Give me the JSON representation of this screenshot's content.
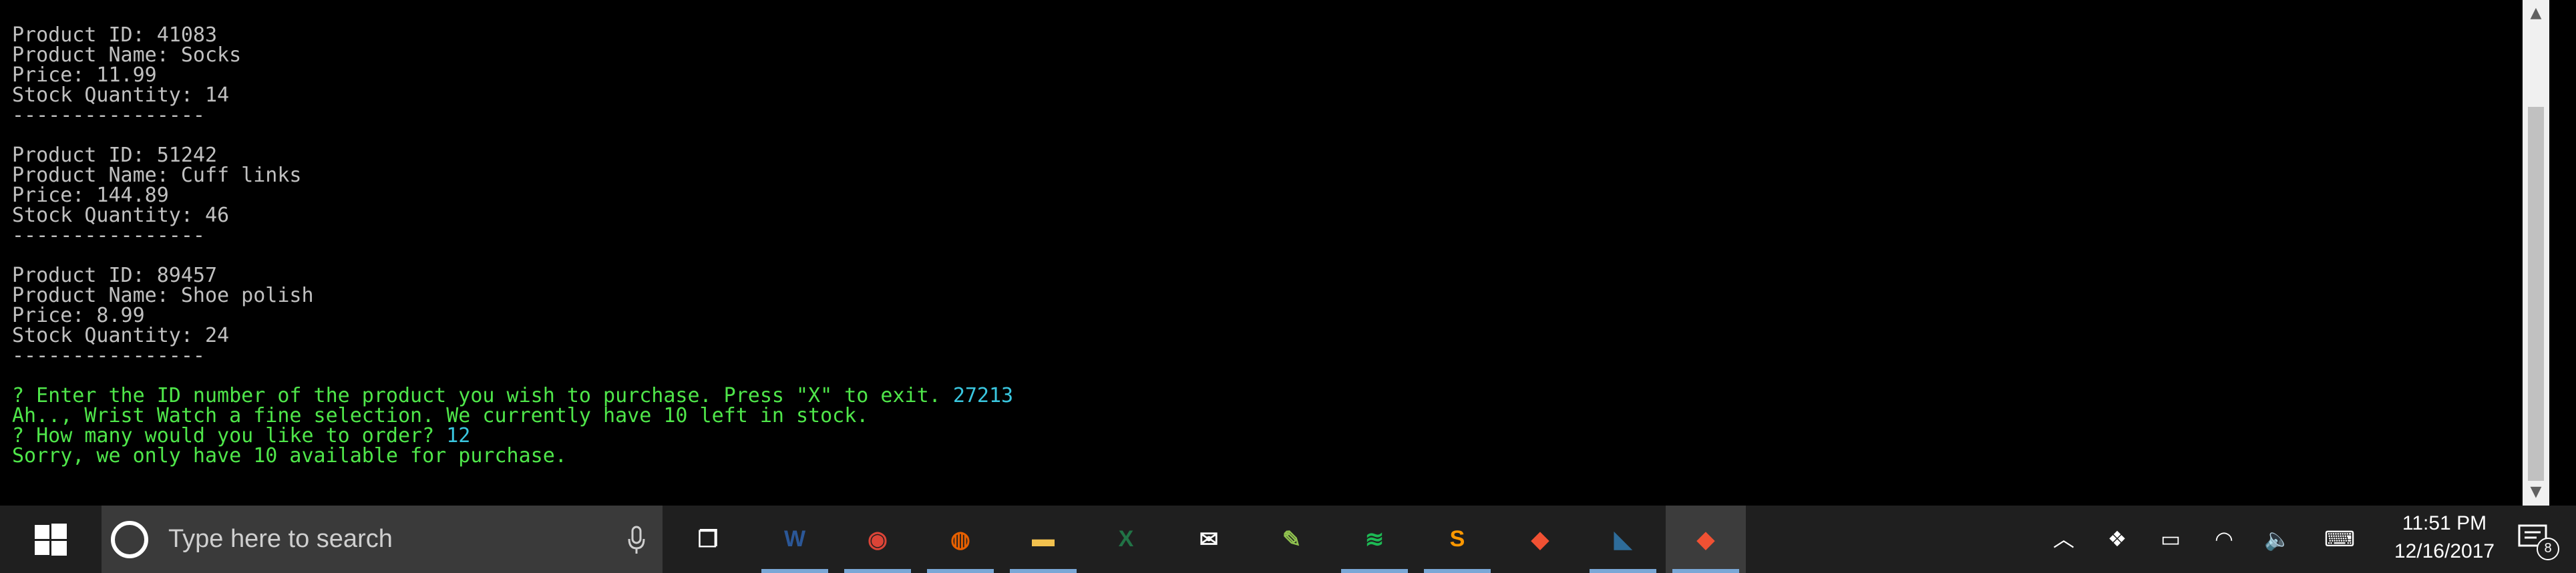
{
  "terminal": {
    "lines": [
      {
        "text": "Product ID: 41083",
        "style": "plain"
      },
      {
        "text": "Product Name: Socks",
        "style": "plain"
      },
      {
        "text": "Price: 11.99",
        "style": "plain"
      },
      {
        "text": "Stock Quantity: 14",
        "style": "plain"
      },
      {
        "text": "----------------",
        "style": "plain"
      },
      {
        "text": "",
        "style": "plain"
      },
      {
        "text": "Product ID: 51242",
        "style": "plain"
      },
      {
        "text": "Product Name: Cuff links",
        "style": "plain"
      },
      {
        "text": "Price: 144.89",
        "style": "plain"
      },
      {
        "text": "Stock Quantity: 46",
        "style": "plain"
      },
      {
        "text": "----------------",
        "style": "plain"
      },
      {
        "text": "",
        "style": "plain"
      },
      {
        "text": "Product ID: 89457",
        "style": "plain"
      },
      {
        "text": "Product Name: Shoe polish",
        "style": "plain"
      },
      {
        "text": "Price: 8.99",
        "style": "plain"
      },
      {
        "text": "Stock Quantity: 24",
        "style": "plain"
      },
      {
        "text": "----------------",
        "style": "plain"
      },
      {
        "text": "",
        "style": "plain"
      },
      {
        "text": "? Enter the ID number of the product you wish to purchase. Press \"X\" to exit. ",
        "style": "green",
        "answer": "27213"
      },
      {
        "text": "Ah.., Wrist Watch a fine selection. We currently have 10 left in stock.",
        "style": "green"
      },
      {
        "text": "? How many would you like to order? ",
        "style": "green",
        "answer": "12"
      },
      {
        "text": "Sorry, we only have 10 available for purchase.",
        "style": "green"
      }
    ]
  },
  "taskbar": {
    "search_placeholder": "Type here to search",
    "apps": [
      {
        "name": "task-view-icon",
        "active": false,
        "open": false,
        "color": "#ffffff"
      },
      {
        "name": "word-icon",
        "active": false,
        "open": true,
        "color": "#2b5797"
      },
      {
        "name": "chrome-icon",
        "active": false,
        "open": true,
        "color": "#db4437"
      },
      {
        "name": "firefox-icon",
        "active": false,
        "open": true,
        "color": "#e66000"
      },
      {
        "name": "file-explorer-icon",
        "active": false,
        "open": true,
        "color": "#f2c14e"
      },
      {
        "name": "excel-icon",
        "active": false,
        "open": false,
        "color": "#217346"
      },
      {
        "name": "mail-icon",
        "active": false,
        "open": false,
        "color": "#ffffff"
      },
      {
        "name": "notepad-plus-icon",
        "active": false,
        "open": false,
        "color": "#90c24f"
      },
      {
        "name": "spotify-icon",
        "active": false,
        "open": true,
        "color": "#1db954"
      },
      {
        "name": "sublime-text-icon",
        "active": false,
        "open": true,
        "color": "#ff9800"
      },
      {
        "name": "git-gui-icon",
        "active": false,
        "open": false,
        "color": "#f05133"
      },
      {
        "name": "mysql-workbench-icon",
        "active": false,
        "open": true,
        "color": "#2e6c9a"
      },
      {
        "name": "git-bash-icon",
        "active": true,
        "open": true,
        "color": "#f05133"
      }
    ],
    "tray": {
      "time": "11:51 PM",
      "date": "12/16/2017",
      "notification_count": "8"
    }
  }
}
